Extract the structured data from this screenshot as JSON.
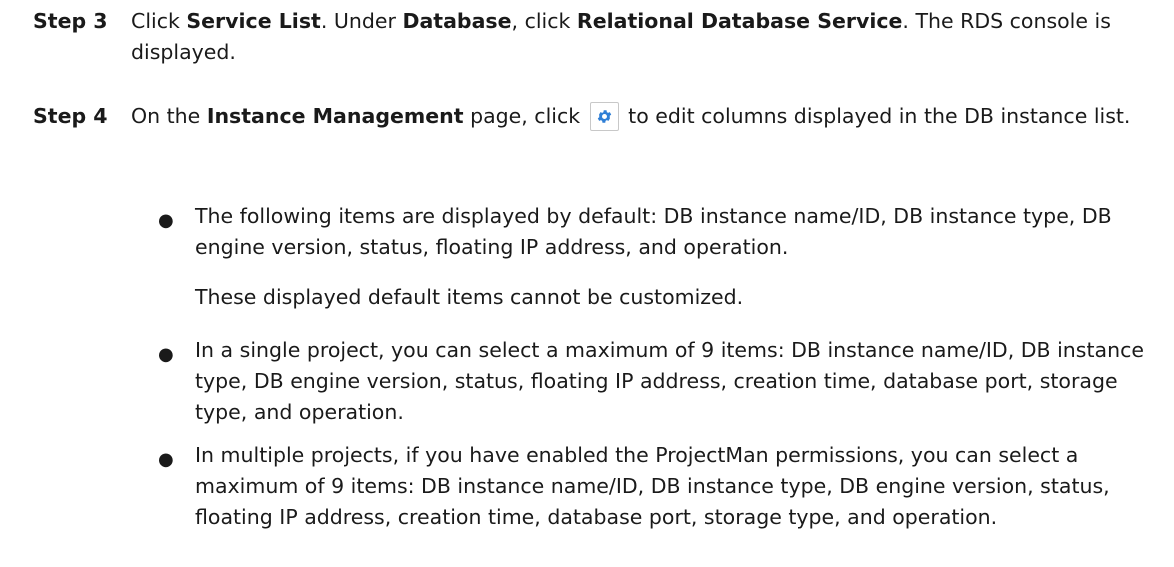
{
  "steps": [
    {
      "label": "Step 3",
      "parts": [
        {
          "t": "Click ",
          "b": false
        },
        {
          "t": "Service List",
          "b": true
        },
        {
          "t": ". Under ",
          "b": false
        },
        {
          "t": "Database",
          "b": true
        },
        {
          "t": ", click ",
          "b": false
        },
        {
          "t": "Relational Database Service",
          "b": true
        },
        {
          "t": ". The RDS console is displayed.",
          "b": false
        }
      ]
    },
    {
      "label": "Step 4",
      "parts_before_icon": [
        {
          "t": "On the ",
          "b": false
        },
        {
          "t": "Instance Management",
          "b": true
        },
        {
          "t": " page, click ",
          "b": false
        }
      ],
      "icon": "gear-icon",
      "parts_after_icon": "to edit columns displayed in the DB instance list."
    }
  ],
  "bullets": [
    {
      "marker": "●",
      "text": "The following items are displayed by default: DB instance name/ID, DB instance type, DB engine version, status, floating IP address, and operation.",
      "note": "These displayed default items cannot be customized."
    },
    {
      "marker": "●",
      "text": "In a single project, you can select a maximum of 9 items: DB instance name/ID, DB instance type, DB engine version, status, floating IP address, creation time, database port, storage type, and operation."
    },
    {
      "marker": "●",
      "text": "In multiple projects, if you have enabled the ProjectMan permissions, you can select a maximum of 9 items: DB instance name/ID, DB instance type, DB engine version, status, floating IP address, creation time, database port, storage type, and operation."
    }
  ],
  "colors": {
    "text": "#1a1a1a",
    "icon_blue": "#2f7fd6"
  }
}
